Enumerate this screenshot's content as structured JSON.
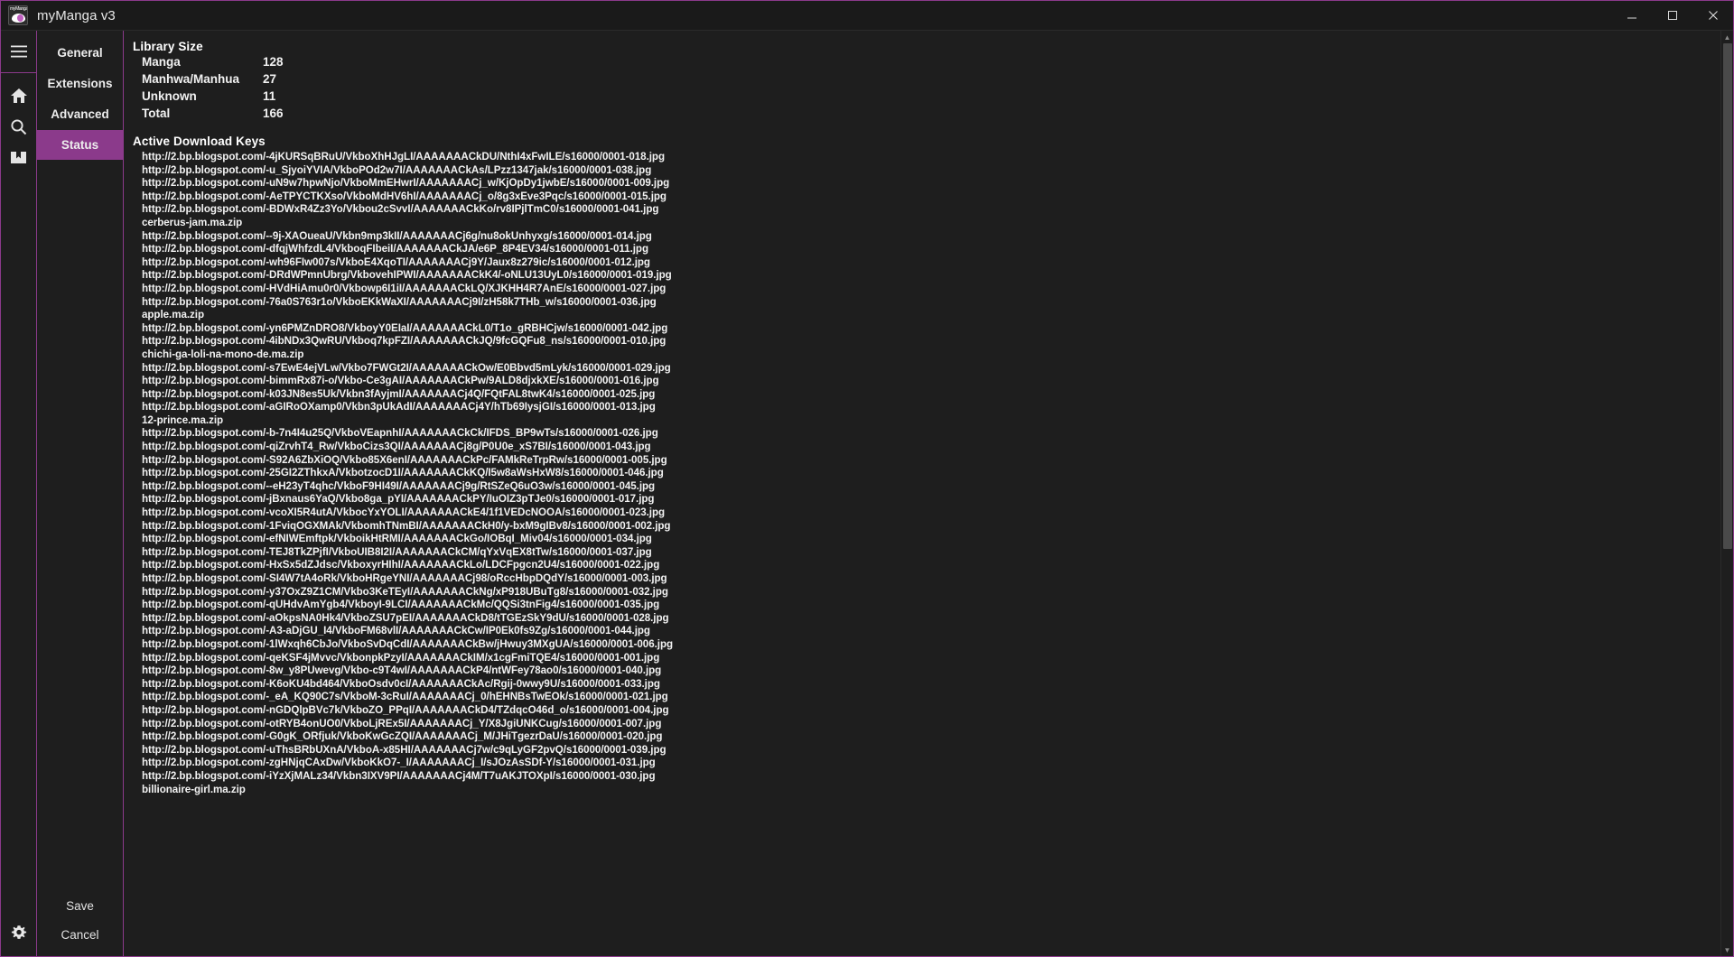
{
  "window": {
    "title": "myManga v3",
    "logo_text": "myManga",
    "minimize_label": "minimize",
    "maximize_label": "maximize",
    "close_label": "close"
  },
  "rail": {
    "items": [
      {
        "name": "menu-icon",
        "label": "Menu"
      },
      {
        "name": "home-icon",
        "label": "Home"
      },
      {
        "name": "search-icon",
        "label": "Search"
      },
      {
        "name": "bookmark-icon",
        "label": "Library"
      }
    ],
    "bottom": {
      "name": "gear-icon",
      "label": "Settings"
    }
  },
  "tabs": [
    {
      "label": "General",
      "active": false
    },
    {
      "label": "Extensions",
      "active": false
    },
    {
      "label": "Advanced",
      "active": false
    },
    {
      "label": "Status",
      "active": true
    }
  ],
  "buttons": {
    "save": "Save",
    "cancel": "Cancel"
  },
  "library_size": {
    "heading": "Library Size",
    "rows": [
      {
        "label": "Manga",
        "value": "128"
      },
      {
        "label": "Manhwa/Manhua",
        "value": "27"
      },
      {
        "label": "Unknown",
        "value": "11"
      },
      {
        "label": "Total",
        "value": "166"
      }
    ]
  },
  "active_download_keys": {
    "heading": "Active Download Keys",
    "items": [
      "http://2.bp.blogspot.com/-4jKURSqBRuU/VkboXhHJgLI/AAAAAAACkDU/NthI4xFwILE/s16000/0001-018.jpg",
      "http://2.bp.blogspot.com/-u_SjyoiYVIA/VkboPOd2w7I/AAAAAAACkAs/LPzz1347jak/s16000/0001-038.jpg",
      "http://2.bp.blogspot.com/-uN9w7hpwNjo/VkboMmEHwrI/AAAAAAACj_w/KjOpDy1jwbE/s16000/0001-009.jpg",
      "http://2.bp.blogspot.com/-AeTPYCTKXso/VkboMdHV6hI/AAAAAAACj_o/8g3xEve3Pqc/s16000/0001-015.jpg",
      "http://2.bp.blogspot.com/-BDWxR4Zz3Yo/Vkbou2cSvvI/AAAAAAACkKo/rv8IPjlTmC0/s16000/0001-041.jpg",
      "cerberus-jam.ma.zip",
      "http://2.bp.blogspot.com/--9j-XAOueaU/Vkbn9mp3kII/AAAAAAACj6g/nu8okUnhyxg/s16000/0001-014.jpg",
      "http://2.bp.blogspot.com/-dfqjWhfzdL4/VkboqFIbeiI/AAAAAAACkJA/e6P_8P4EV34/s16000/0001-011.jpg",
      "http://2.bp.blogspot.com/-wh96FIw007s/VkboE4XqoTI/AAAAAAACj9Y/Jaux8z279ic/s16000/0001-012.jpg",
      "http://2.bp.blogspot.com/-DRdWPmnUbrg/VkbovehIPWI/AAAAAAACkK4/-oNLU13UyL0/s16000/0001-019.jpg",
      "http://2.bp.blogspot.com/-HVdHiAmu0r0/Vkbowp6I1iI/AAAAAAACkLQ/XJKHH4R7AnE/s16000/0001-027.jpg",
      "http://2.bp.blogspot.com/-76a0S763r1o/VkboEKkWaXI/AAAAAAACj9I/zH58k7THb_w/s16000/0001-036.jpg",
      "apple.ma.zip",
      "http://2.bp.blogspot.com/-yn6PMZnDRO8/VkboyY0EIaI/AAAAAAACkL0/T1o_gRBHCjw/s16000/0001-042.jpg",
      "http://2.bp.blogspot.com/-4ibNDx3QwRU/Vkboq7kpFZI/AAAAAAACkJQ/9fcGQFu8_ns/s16000/0001-010.jpg",
      "chichi-ga-loli-na-mono-de.ma.zip",
      "http://2.bp.blogspot.com/-s7EwE4ejVLw/Vkbo7FWGt2I/AAAAAAACkOw/E0Bbvd5mLyk/s16000/0001-029.jpg",
      "http://2.bp.blogspot.com/-bimmRx87i-o/Vkbo-Ce3gAI/AAAAAAACkPw/9ALD8djxkXE/s16000/0001-016.jpg",
      "http://2.bp.blogspot.com/-k03JN8es5Uk/Vkbn3fAyjmI/AAAAAAACj4Q/FQtFAL8twK4/s16000/0001-025.jpg",
      "http://2.bp.blogspot.com/-aGIRoOXamp0/Vkbn3pUkAdI/AAAAAAACj4Y/hTb69IysjGI/s16000/0001-013.jpg",
      "12-prince.ma.zip",
      "http://2.bp.blogspot.com/-b-7n4I4u25Q/VkboVEapnhI/AAAAAAACkCk/IFDS_BP9wTs/s16000/0001-026.jpg",
      "http://2.bp.blogspot.com/-qiZrvhT4_Rw/VkboCizs3QI/AAAAAAACj8g/P0U0e_xS7BI/s16000/0001-043.jpg",
      "http://2.bp.blogspot.com/-S92A6ZbXiOQ/Vkbo85X6enI/AAAAAAACkPc/FAMkReTrpRw/s16000/0001-005.jpg",
      "http://2.bp.blogspot.com/-25GI2ZThkxA/VkbotzocD1I/AAAAAAACkKQ/I5w8aWsHxW8/s16000/0001-046.jpg",
      "http://2.bp.blogspot.com/--eH23yT4qhc/VkboF9HI49I/AAAAAAACj9g/RtSZeQ6uO3w/s16000/0001-045.jpg",
      "http://2.bp.blogspot.com/-jBxnaus6YaQ/Vkbo8ga_pYI/AAAAAAACkPY/IuOIZ3pTJe0/s16000/0001-017.jpg",
      "http://2.bp.blogspot.com/-vcoXI5R4utA/VkbocYxYOLI/AAAAAAACkE4/1f1VEDcNOOA/s16000/0001-023.jpg",
      "http://2.bp.blogspot.com/-1FviqOGXMAk/VkbomhTNmBI/AAAAAAACkH0/y-bxM9gIBv8/s16000/0001-002.jpg",
      "http://2.bp.blogspot.com/-efNIWEmftpk/VkboikHtRMI/AAAAAAACkGo/IOBqI_Miv04/s16000/0001-034.jpg",
      "http://2.bp.blogspot.com/-TEJ8TkZPjfI/VkboUIB8I2I/AAAAAAACkCM/qYxVqEX8tTw/s16000/0001-037.jpg",
      "http://2.bp.blogspot.com/-HxSx5dZJdsc/VkboxyrHIhI/AAAAAAACkLo/LDCFpgcn2U4/s16000/0001-022.jpg",
      "http://2.bp.blogspot.com/-SI4W7tA4oRk/VkboHRgeYNI/AAAAAAACj98/oRccHbpDQdY/s16000/0001-003.jpg",
      "http://2.bp.blogspot.com/-y37OxZ9Z1CM/Vkbo3KeTEyI/AAAAAAACkNg/xP918UBuTg8/s16000/0001-032.jpg",
      "http://2.bp.blogspot.com/-qUHdvAmYgb4/VkboyI-9LCI/AAAAAAACkMc/QQSi3tnFig4/s16000/0001-035.jpg",
      "http://2.bp.blogspot.com/-aOkpsNA0Hk4/VkboZSU7pEI/AAAAAAACkD8/tTGEzSkY9dU/s16000/0001-028.jpg",
      "http://2.bp.blogspot.com/-A3-aDjGU_I4/VkboFM68vlI/AAAAAAACkCw/IP0Ek0fs9Zg/s16000/0001-044.jpg",
      "http://2.bp.blogspot.com/-1lWxqh6CbJo/VkboSvDqCdI/AAAAAAACkBw/jHwuy3MXgUA/s16000/0001-006.jpg",
      "http://2.bp.blogspot.com/-qeKSF4jMvvc/VkbonpkPzyI/AAAAAAACkIM/x1cgFmiTQE4/s16000/0001-001.jpg",
      "http://2.bp.blogspot.com/-8w_y8PUwevg/Vkbo-c9T4wI/AAAAAAACkP4/ntWFey78ao0/s16000/0001-040.jpg",
      "http://2.bp.blogspot.com/-K6oKU4bd464/VkboOsdv0cI/AAAAAAACkAc/Rgij-0wwy9U/s16000/0001-033.jpg",
      "http://2.bp.blogspot.com/-_eA_KQ90C7s/VkboM-3cRuI/AAAAAAACj_0/hEHNBsTwEOk/s16000/0001-021.jpg",
      "http://2.bp.blogspot.com/-nGDQlpBVc7k/VkboZO_PPqI/AAAAAAACkD4/TZdqcO46d_o/s16000/0001-004.jpg",
      "http://2.bp.blogspot.com/-otRYB4onUO0/VkboLjREx5I/AAAAAAACj_Y/X8JgiUNKCug/s16000/0001-007.jpg",
      "http://2.bp.blogspot.com/-G0gK_ORfjuk/VkboKwGcZQI/AAAAAAACj_M/JHiTgezrDaU/s16000/0001-020.jpg",
      "http://2.bp.blogspot.com/-uThsBRbUXnA/VkboA-x85HI/AAAAAAACj7w/c9qLyGF2pvQ/s16000/0001-039.jpg",
      "http://2.bp.blogspot.com/-zgHNjqCAxDw/VkboKkO7-_I/AAAAAAACj_I/sJOzAsSDf-Y/s16000/0001-031.jpg",
      "http://2.bp.blogspot.com/-iYzXjMALz34/Vkbn3IXV9PI/AAAAAAACj4M/T7uAKJTOXpI/s16000/0001-030.jpg",
      "billionaire-girl.ma.zip"
    ]
  },
  "colors": {
    "accent": "#8b3a8b",
    "background": "#1e1e1e",
    "text": "#f2f2f2"
  },
  "scrollbar": {
    "up_arrow": "▲",
    "down_arrow": "▼"
  }
}
